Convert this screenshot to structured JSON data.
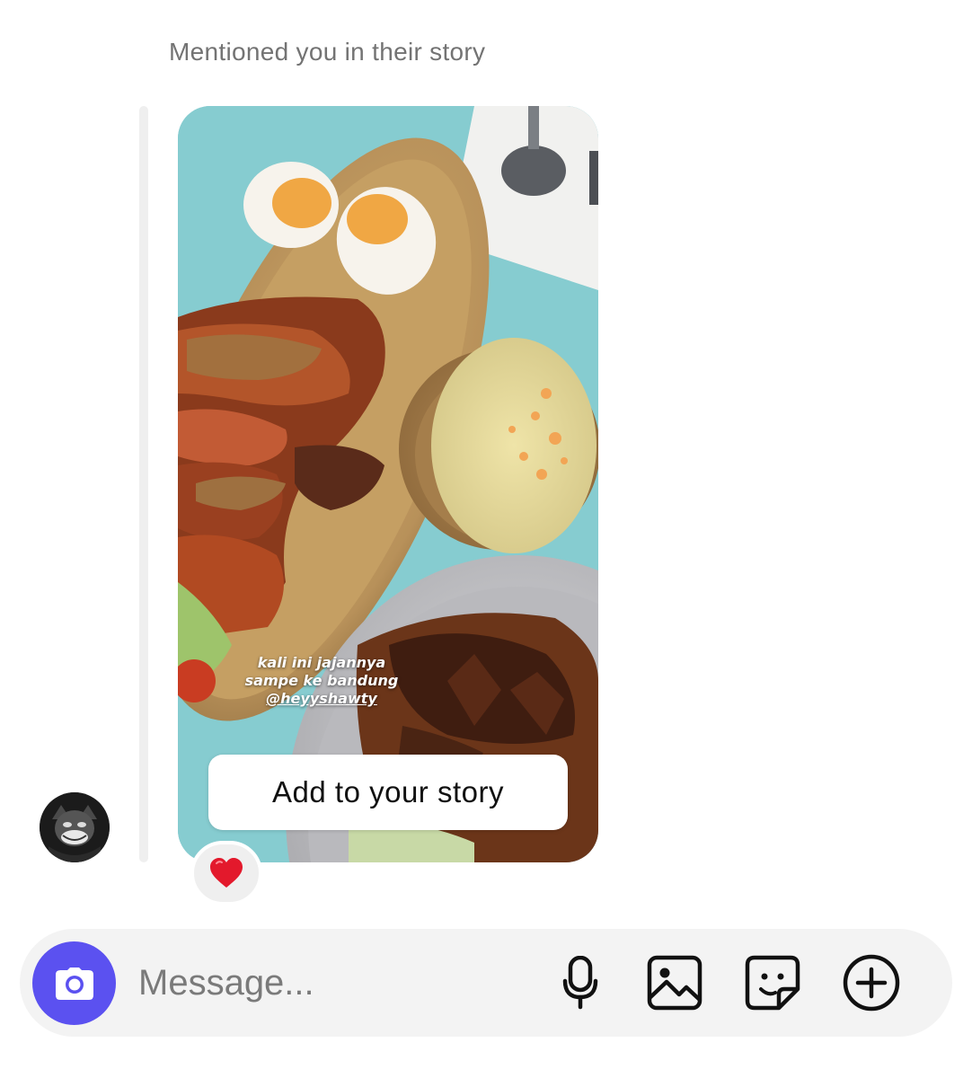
{
  "thread": {
    "mention_header": "Mentioned you in their story"
  },
  "story": {
    "caption_lines": [
      "kali ini jajannya",
      "sampe ke bandung"
    ],
    "caption_mention": "@heyyshawty",
    "add_to_story_label": "Add to your story"
  },
  "reaction": {
    "emoji": "❤️"
  },
  "composer": {
    "placeholder": "Message...",
    "icons": [
      "camera-icon",
      "microphone-icon",
      "gallery-icon",
      "sticker-icon",
      "add-circle-icon"
    ]
  },
  "colors": {
    "camera_button": "#5b51f0",
    "composer_background": "#f3f3f3",
    "header_text": "#737373"
  }
}
